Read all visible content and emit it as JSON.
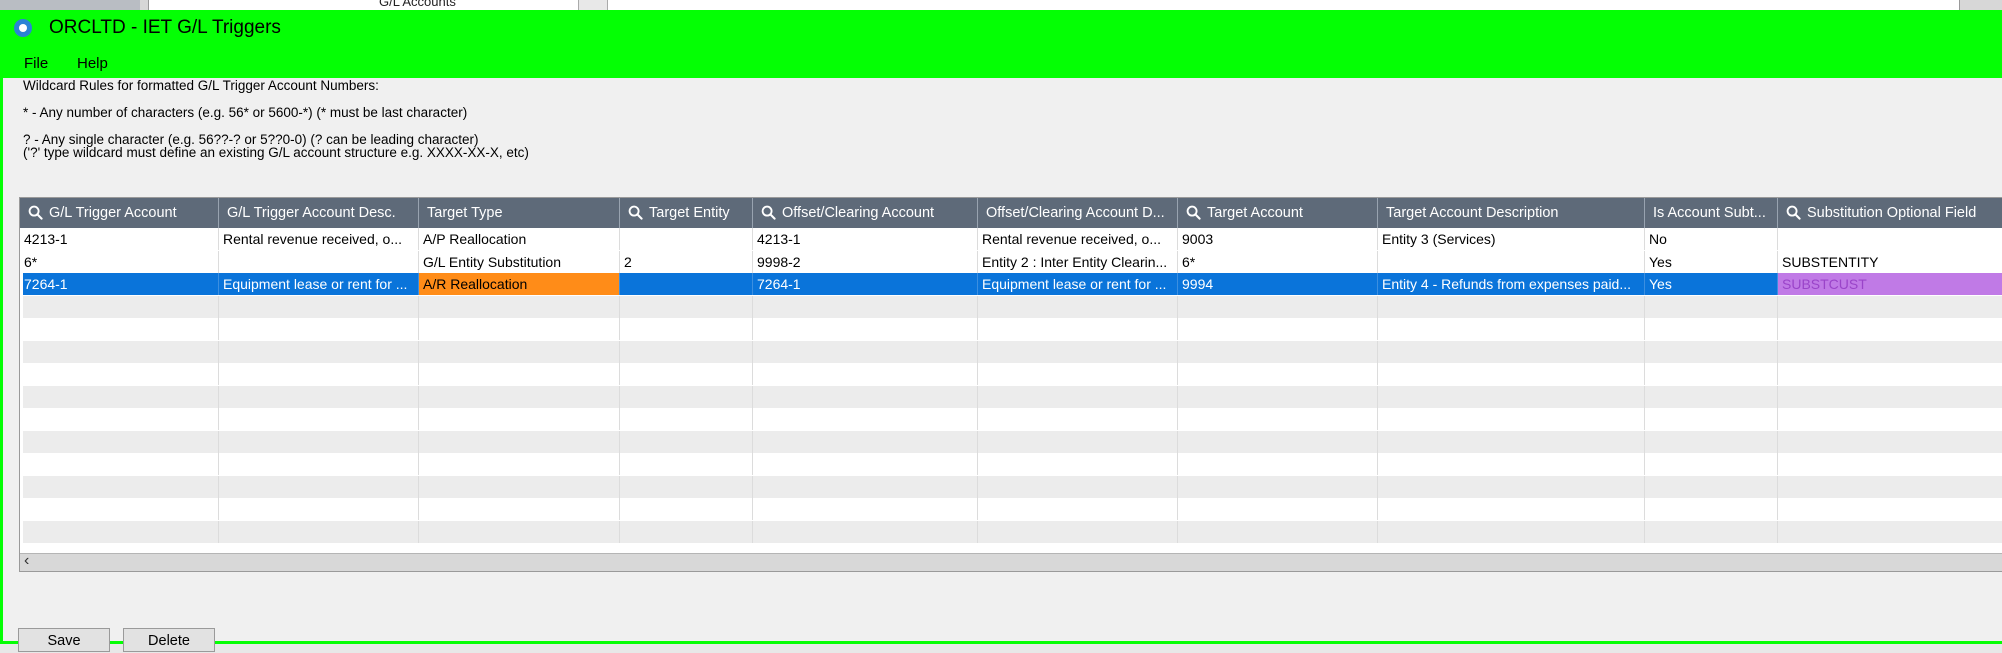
{
  "background_app": {
    "crumb": "G/L Accounts"
  },
  "window": {
    "title": "ORCLTD - IET G/L Triggers",
    "title_bar_color": "#04ff04",
    "menu": [
      "File",
      "Help"
    ]
  },
  "rules": {
    "heading": "Wildcard Rules for formatted G/L Trigger Account Numbers:",
    "star": "* - Any number of characters (e.g. 56* or 5600-*) (* must be last character)",
    "question": "? - Any single character (e.g. 56??-? or 5??0-0) (? can be leading character)",
    "note": "('?' type wildcard must define an existing G/L account structure e.g. XXXX-XX-X, etc)"
  },
  "grid": {
    "columns": [
      {
        "label": "G/L Trigger Account",
        "search": true
      },
      {
        "label": "G/L Trigger Account Desc.",
        "search": false
      },
      {
        "label": "Target Type",
        "search": false
      },
      {
        "label": "Target Entity",
        "search": true
      },
      {
        "label": "Offset/Clearing Account",
        "search": true
      },
      {
        "label": "Offset/Clearing Account D...",
        "search": false
      },
      {
        "label": "Target Account",
        "search": true
      },
      {
        "label": "Target Account Description",
        "search": false
      },
      {
        "label": "Is Account Subt...",
        "search": false
      },
      {
        "label": "Substitution Optional Field",
        "search": true
      }
    ],
    "rows": [
      [
        "4213-1",
        "Rental revenue received, o...",
        "A/P Reallocation",
        "",
        "4213-1",
        "Rental revenue received, o...",
        "9003",
        "Entity 3 (Services)",
        "No",
        ""
      ],
      [
        "6*",
        "",
        "G/L Entity Substitution",
        "2",
        "9998-2",
        "Entity 2 : Inter Entity Clearin...",
        "6*",
        "",
        "Yes",
        "SUBSTENTITY"
      ],
      [
        "7264-1",
        "Equipment lease or rent for ...",
        "A/R Reallocation",
        "",
        "7264-1",
        "Equipment lease or rent for ...",
        "9994",
        "Entity 4 - Refunds from expenses paid...",
        "Yes",
        "SUBSTCUST"
      ]
    ],
    "selected_row": 2,
    "highlight_colors": {
      "selection": "#0a74da",
      "target_type": "#ff8c18",
      "optional_field": "#c07ae6"
    }
  },
  "buttons": {
    "save": "Save",
    "delete": "Delete"
  }
}
